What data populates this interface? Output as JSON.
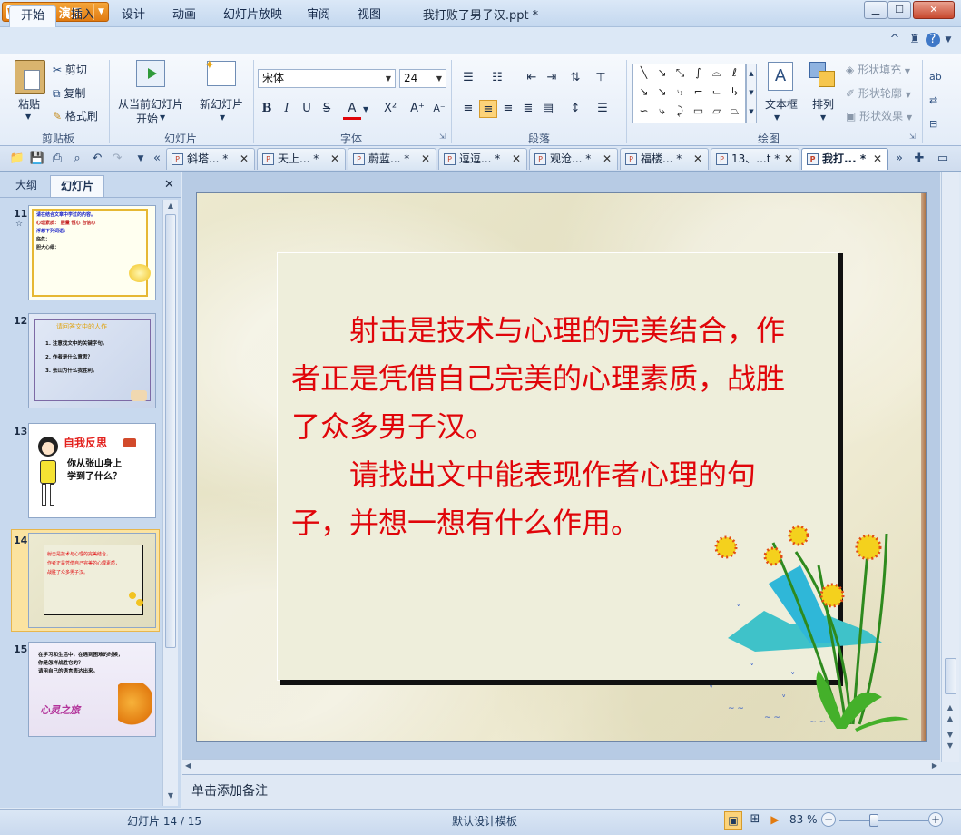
{
  "app": {
    "name": "WPS 演示",
    "window_title": "我打败了男子汉.ppt *"
  },
  "menu_tabs": [
    "开始",
    "插入",
    "设计",
    "动画",
    "幻灯片放映",
    "审阅",
    "视图"
  ],
  "ribbon": {
    "clipboard": {
      "paste": "粘贴",
      "cut": "剪切",
      "copy": "复制",
      "format_painter": "格式刷",
      "group": "剪贴板"
    },
    "slides": {
      "from_current": "从当前幻灯片",
      "start": "开始",
      "new_slide": "新幻灯片",
      "group": "幻灯片"
    },
    "font": {
      "name": "宋体",
      "size": "24",
      "group": "字体"
    },
    "paragraph": {
      "group": "段落"
    },
    "drawing": {
      "text_box": "文本框",
      "arrange": "排列",
      "shape_fill": "形状填充",
      "shape_outline": "形状轮廓",
      "shape_effects": "形状效果",
      "group": "绘图"
    }
  },
  "doc_tabs": [
    {
      "label": "斜塔... *",
      "active": false
    },
    {
      "label": "天上... *",
      "active": false
    },
    {
      "label": "蔚蓝... *",
      "active": false
    },
    {
      "label": "逗逗... *",
      "active": false
    },
    {
      "label": "观沧... *",
      "active": false
    },
    {
      "label": "福楼... *",
      "active": false
    },
    {
      "label": "13、...t *",
      "active": false
    },
    {
      "label": "我打... *",
      "active": true
    }
  ],
  "panel": {
    "tab_outline": "大纲",
    "tab_slides": "幻灯片"
  },
  "thumbnails": [
    {
      "num": "11",
      "lines": [
        "请在结合文章中学过的内容。",
        "心理素质：   胆量   恒心   自信心",
        "",
        "浮想下列词语：",
        "临危：",
        "胆大心细："
      ]
    },
    {
      "num": "12",
      "title": "请回答文中的人作",
      "lines": [
        "1. 注意找文中的关键字句。",
        "2. 作者是什么意思？",
        "3. 张山为什么我胜利。"
      ]
    },
    {
      "num": "13",
      "title": "自我反思",
      "lines": [
        "你从张山身上",
        "学到了什么？"
      ]
    },
    {
      "num": "14",
      "lines": [
        "射击是技术与心理的完美结合，",
        "作者正是凭借自己完美的心理素质，",
        "战胜了众多男子汉。"
      ]
    },
    {
      "num": "15",
      "lines": [
        "在学习和生活中，在遇到困难的时候，",
        "你是怎样战胜它的？",
        "请用自己的语言表达出来。"
      ],
      "title": "心灵之旅"
    }
  ],
  "slide": {
    "paragraphs": [
      "　　射击是技术与心理的完美结合，作者正是凭借自己完美的心理素质，战胜了众多男子汉。",
      "　　请找出文中能表现作者心理的句子，并想一想有什么作用。"
    ],
    "text_color": "#e0050a"
  },
  "notes_placeholder": "单击添加备注",
  "status": {
    "slide_counter": "幻灯片 14 / 15",
    "template": "默认设计模板",
    "zoom": "83 %"
  }
}
